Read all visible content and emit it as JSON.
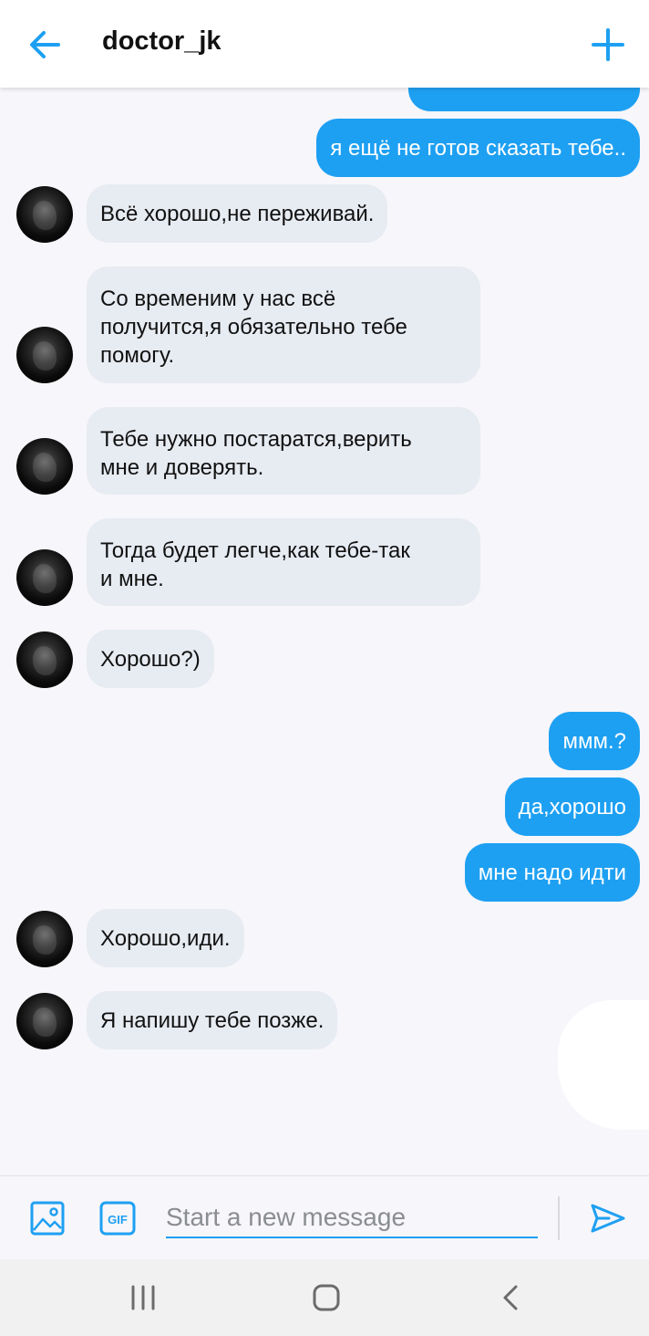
{
  "header": {
    "title": "doctor_jk",
    "back_icon": "arrow-left-icon",
    "add_icon": "plus-icon",
    "accent_color": "#1ea0f2"
  },
  "messages": [
    {
      "side": "out",
      "text": "я ещё не готов сказать тебе.."
    },
    {
      "side": "in",
      "text": "Всё хорошо,не переживай."
    },
    {
      "side": "in",
      "lines": [
        "Со временим у нас всё",
        "получится,я обязательно тебе",
        "помогу."
      ]
    },
    {
      "side": "in",
      "lines": [
        "Тебе нужно постаратся,верить",
        "мне и доверять."
      ]
    },
    {
      "side": "in",
      "lines": [
        "Тогда будет легче,как тебе-так",
        "и мне."
      ]
    },
    {
      "side": "in",
      "text": "Хорошо?)"
    },
    {
      "side": "out",
      "text": "ммм.?"
    },
    {
      "side": "out",
      "text": "да,хорошо"
    },
    {
      "side": "out",
      "text": "мне надо идти"
    },
    {
      "side": "in",
      "text": "Хорошо,иди."
    },
    {
      "side": "in",
      "text": "Я напишу тебе позже."
    }
  ],
  "composer": {
    "placeholder": "Start a new message",
    "value": "",
    "image_icon": "image-icon",
    "gif_icon": "gif-icon",
    "gif_label": "GIF",
    "send_icon": "send-icon"
  },
  "system_nav": {
    "recent_icon": "recent-apps-icon",
    "home_icon": "home-icon",
    "back_icon": "back-chevron-icon"
  },
  "colors": {
    "incoming_bubble": "#e7ebf2",
    "outgoing_bubble": "#1ea0f2",
    "background": "#f7f6fa"
  }
}
